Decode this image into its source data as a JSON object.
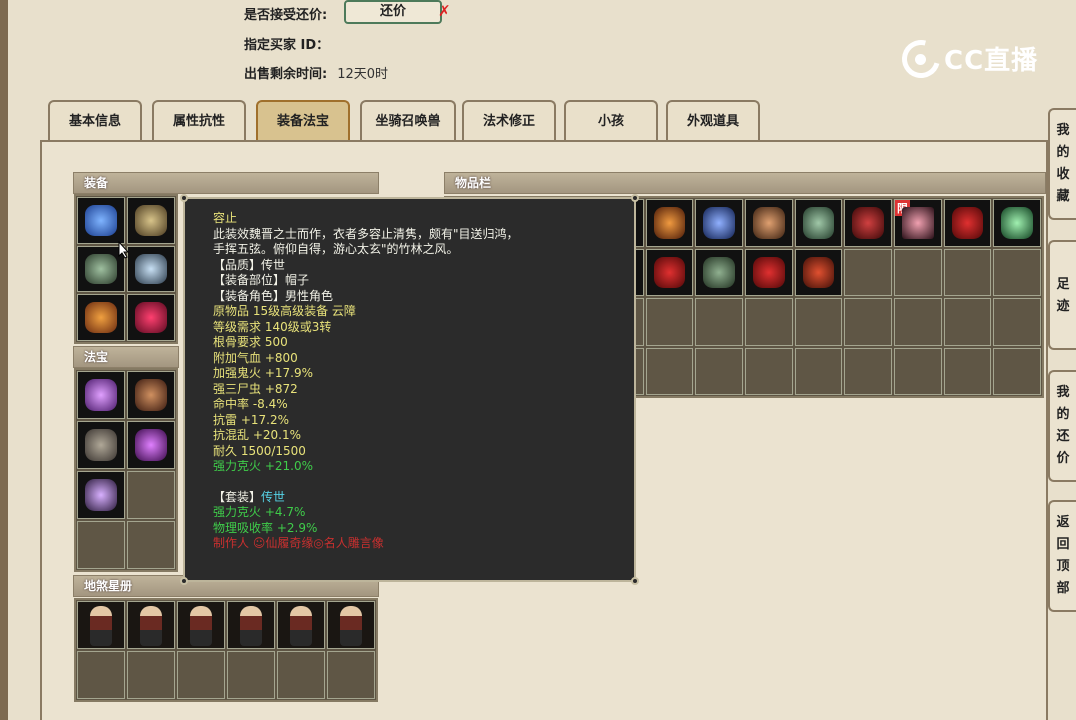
{
  "sale_info": {
    "accept_counter_label": "是否接受还价:",
    "counter_button": "还价",
    "counter_mark": "✗",
    "buyer_id_label": "指定买家 ID：",
    "buyer_id_value": "",
    "remaining_time_label": "出售剩余时间:",
    "remaining_time_value": "12天0时"
  },
  "watermark": {
    "text": "CC直播"
  },
  "tabs": [
    {
      "label": "基本信息"
    },
    {
      "label": "属性抗性"
    },
    {
      "label": "装备法宝",
      "active": true
    },
    {
      "label": "坐骑召唤兽"
    },
    {
      "label": "法术修正"
    },
    {
      "label": "小孩"
    },
    {
      "label": "外观道具"
    }
  ],
  "sections": {
    "equipment": "装备",
    "magic_treasure": "法宝",
    "star_book": "地煞星册",
    "inventory": "物品栏"
  },
  "inventory": {
    "limit_badge": "限"
  },
  "tooltip": {
    "name": "容止",
    "description": "此装效魏晋之士而作，衣者多容止清隽，颇有\"目送归鸿，手挥五弦。俯仰自得，游心太玄\"的竹林之风。",
    "quality": "【品质】传世",
    "slot": "【装备部位】帽子",
    "role": "【装备角色】男性角色",
    "original_item": "原物品 15级高级装备 云障",
    "level_req": "等级需求 140级或3转",
    "bone_req": "根骨要求 500",
    "stats": [
      "附加气血 +800",
      "加强鬼火 +17.9%",
      "强三尸虫 +872",
      "命中率 -8.4%",
      "抗雷 +17.2%",
      "抗混乱 +20.1%",
      "耐久 1500/1500"
    ],
    "green_stat": "强力克火 +21.0%",
    "set_label": "【套装】",
    "set_name": "传世",
    "set_stats": [
      "强力克火 +4.7%",
      "物理吸收率 +2.9%"
    ],
    "maker": "制作人 ☺仙履奇缘◎名人雕言像"
  },
  "side_buttons": [
    {
      "label": "我的收藏"
    },
    {
      "label": "足迹"
    },
    {
      "label": "我的还价"
    },
    {
      "label": "返回顶部"
    }
  ]
}
